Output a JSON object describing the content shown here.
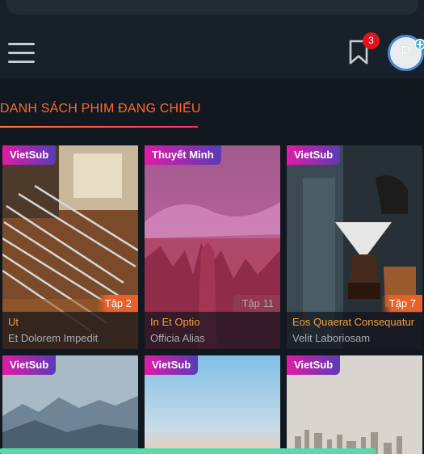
{
  "header": {
    "notification_count": "3",
    "avatar_letter": "P"
  },
  "section": {
    "title": "DANH SÁCH PHIM ĐANG CHIẾU"
  },
  "movies": [
    {
      "tag": "VietSub",
      "episode": "Tập 2",
      "title": "Ut",
      "subtitle": "Et Dolorem Impedit"
    },
    {
      "tag": "Thuyết Minh",
      "episode": "Tập 11",
      "title": "In Et Optio",
      "subtitle": "Officia Alias"
    },
    {
      "tag": "VietSub",
      "episode": "Tập 7",
      "title": "Eos Quaerat Consequatur",
      "subtitle": "Velit Laboriosam"
    },
    {
      "tag": "VietSub"
    },
    {
      "tag": "VietSub"
    },
    {
      "tag": "VietSub"
    }
  ],
  "colors": {
    "accent": "#ff6b2c",
    "tag_gradient_start": "#e01ba6",
    "tag_gradient_end": "#5a3bb5",
    "badge": "#e0141c",
    "title": "#f5a23c"
  },
  "icons": [
    "hamburger-menu-icon",
    "bookmark-icon",
    "plus-icon"
  ]
}
